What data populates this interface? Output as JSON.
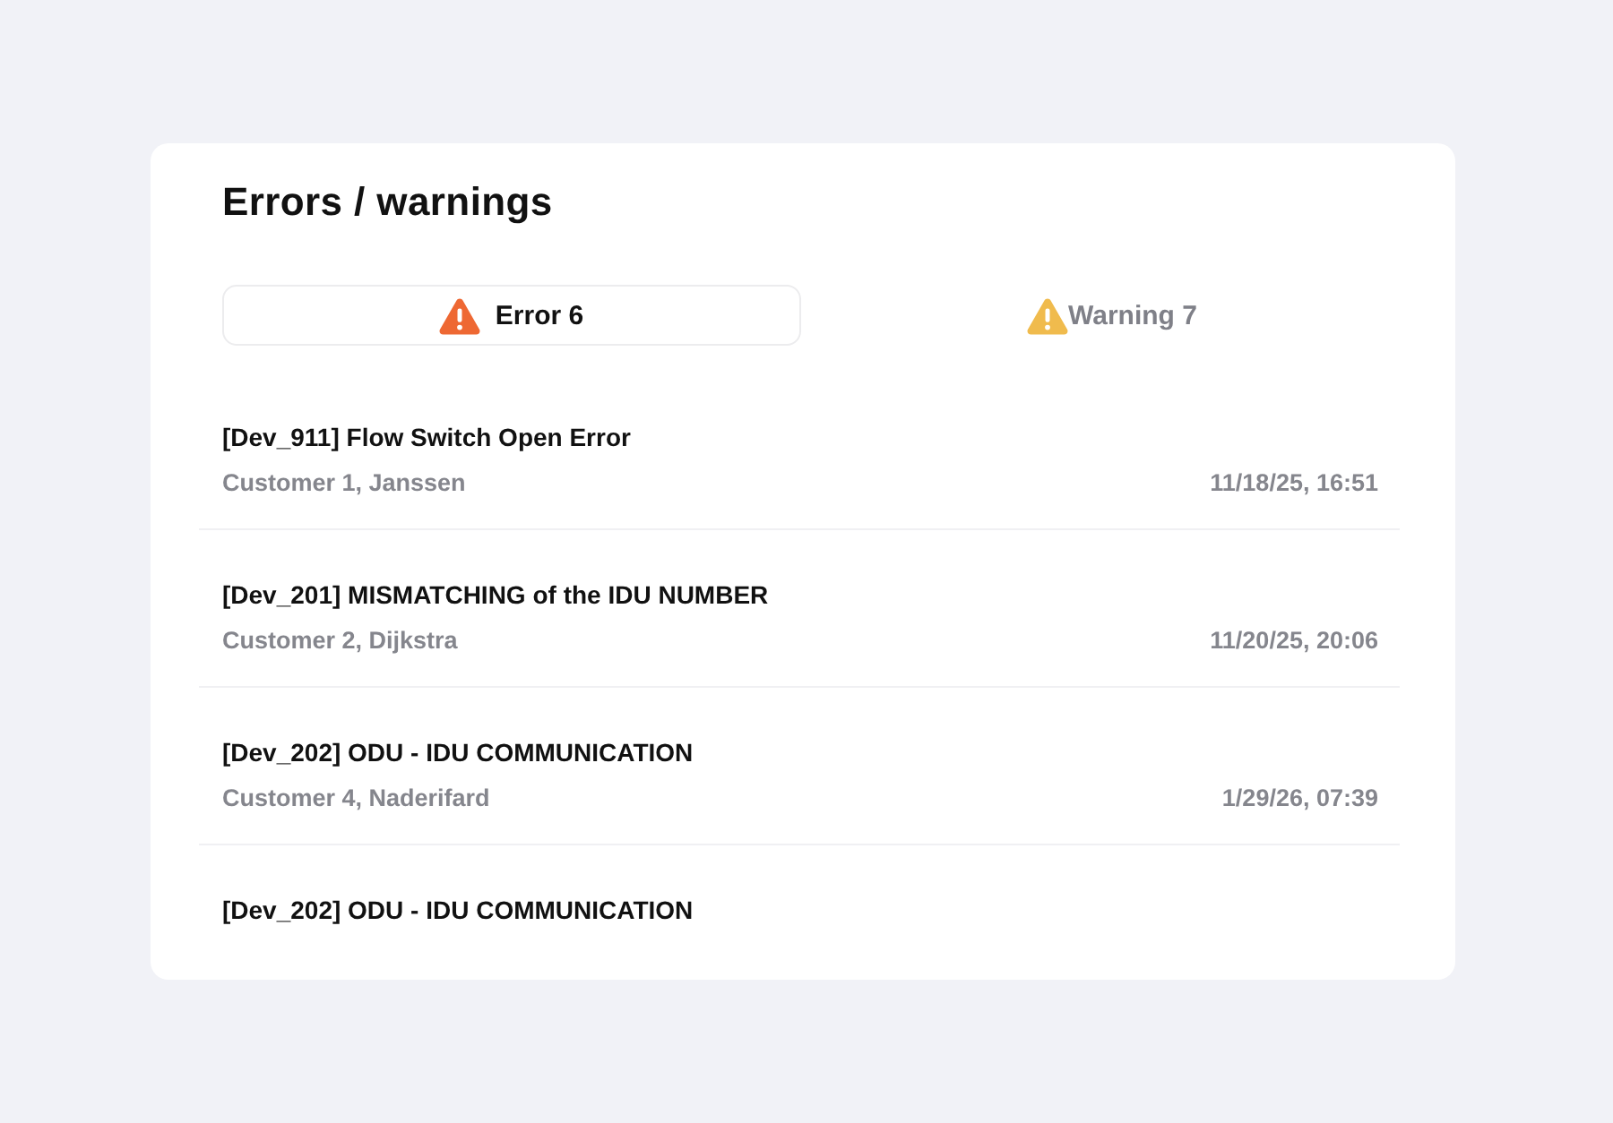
{
  "title": "Errors / warnings",
  "tabs": [
    {
      "label": "Error 6",
      "color": "#ee6833",
      "selected": true
    },
    {
      "label": "Warning 7",
      "color": "#f0bb4d",
      "selected": false
    }
  ],
  "items": [
    {
      "title": "[Dev_911] Flow Switch Open Error",
      "customer": "Customer 1, Janssen",
      "time": "11/18/25, 16:51"
    },
    {
      "title": "[Dev_201] MISMATCHING of the IDU NUMBER",
      "customer": "Customer 2, Dijkstra",
      "time": "11/20/25, 20:06"
    },
    {
      "title": "[Dev_202] ODU - IDU COMMUNICATION",
      "customer": "Customer 4, Naderifard",
      "time": "1/29/26, 07:39"
    },
    {
      "title": "[Dev_202] ODU - IDU COMMUNICATION"
    }
  ]
}
